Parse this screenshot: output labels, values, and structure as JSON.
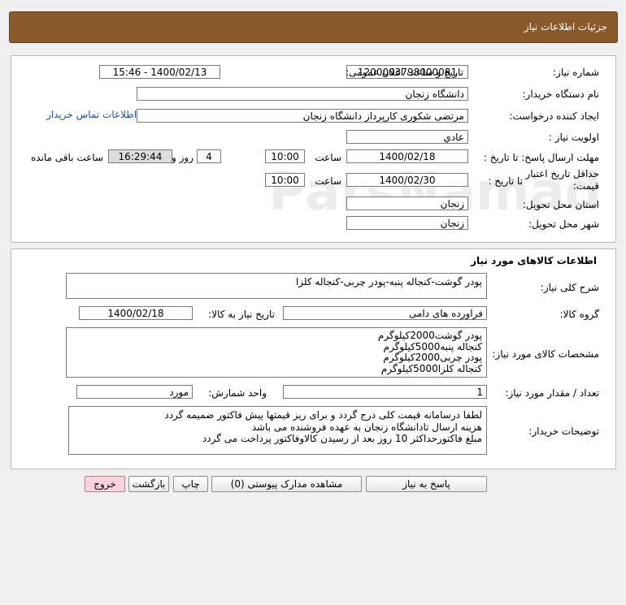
{
  "header": {
    "title": "جزئیات اطلاعات نیاز"
  },
  "info": {
    "need_no_label": "شماره نیاز:",
    "need_no": "1200003798000081",
    "announce_label": "تاریخ و ساعت اعلان عمومی:",
    "announce_value": "1400/02/13 - 15:46",
    "buyer_label": "نام دستگاه خریدار:",
    "buyer_value": "دانشگاه زنجان",
    "creator_label": "ایجاد کننده درخواست:",
    "creator_value": "مرتضی شکوری کارپرداز دانشگاه زنجان",
    "contact_link": "اطلاعات تماس خریدار",
    "priority_label": "اولویت نیاز :",
    "priority_value": "عادي",
    "deadline_label": "مهلت ارسال پاسخ: تا تاریخ :",
    "deadline_date": "1400/02/18",
    "time_label": "ساعت",
    "deadline_time": "10:00",
    "days_value": "4",
    "days_label": "روز و",
    "remaining_time": "16:29:44",
    "remaining_label": "ساعت باقی مانده",
    "validity_label_1": "حداقل تاریخ اعتبار",
    "validity_label_2": "قیمت:",
    "validity_to_label": "تا تاریخ :",
    "validity_date": "1400/02/30",
    "validity_time": "10:00",
    "province_label": "استان محل تحویل:",
    "province_value": "زنجان",
    "city_label": "شهر محل تحویل:",
    "city_value": "زنجان"
  },
  "goods": {
    "section_title": "اطلاعات کالاهای مورد نیاز",
    "general_desc_label": "شرح کلی نیاز:",
    "general_desc": "پودر گوشت-کنجاله پنبه-پودر چربی-کنجاله کلزا",
    "group_label": "گروه کالا:",
    "group_value": "فراورده های دامی",
    "need_date_label": "تاریخ نیاز به کالا:",
    "need_date": "1400/02/18",
    "specs_label": "مشخصات کالای مورد نیاز:",
    "specs": "پودر گوشت2000کیلوگرم\nکنجاله پنبه5000کیلوگرم\nپودر چربی2000کیلوگرم\nکنجاله کلزا5000کیلوگرم",
    "qty_label": "تعداد / مقدار مورد نیاز:",
    "qty_value": "1",
    "unit_label": "واحد شمارش:",
    "unit_value": "مورد",
    "buyer_notes_label": "توضیحات خریدار:",
    "buyer_notes": "لطفا درسامانه قیمت کلی درج گردد و برای ریز قیمتها پیش فاکتور ضمیمه گردد\nهزینه ارسال تادانشگاه زنجان به عهده فروشنده می باشد\nمبلغ فاکتورحداکثر 10 روز  بعد از رسیدن کالاوفاکتور پرداخت می گردد"
  },
  "buttons": {
    "reply": "پاسخ به نیاز",
    "attachments": "مشاهده مدارک پیوستی (0)",
    "print": "چاپ",
    "back": "بازگشت",
    "exit": "خروج"
  }
}
